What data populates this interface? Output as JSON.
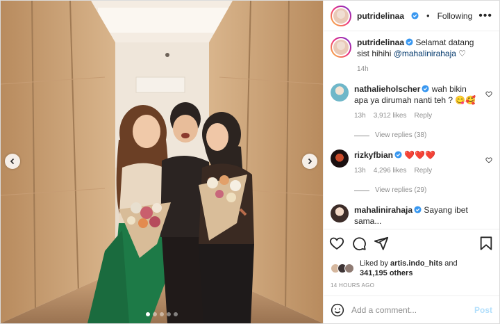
{
  "header": {
    "username": "putridelinaa",
    "separator": "•",
    "follow_status": "Following",
    "more_label": "•••"
  },
  "comments": [
    {
      "username": "putridelinaa",
      "text": "Selamat datang sist hihihi",
      "mention": "@mahalinirahaja",
      "suffix": "♡",
      "time": "14h"
    },
    {
      "username": "nathalieholscher",
      "text": "wah bikin apa ya dirumah nanti teh ? 😋🥰",
      "time": "13h",
      "likes": "3,912 likes",
      "reply": "Reply",
      "view_replies": "View replies (38)"
    },
    {
      "username": "rizkyfbian",
      "text": "❤️❤️❤️",
      "time": "13h",
      "likes": "4,296 likes",
      "reply": "Reply",
      "view_replies": "View replies (29)"
    },
    {
      "username": "mahalinirahaja",
      "text": "Sayang ibet sama..."
    }
  ],
  "liked_by": {
    "prefix": "Liked by",
    "user": "artis.indo_hits",
    "joiner": "and",
    "count": "341,195 others"
  },
  "timestamp": "14 HOURS AGO",
  "add_comment": {
    "placeholder": "Add a comment...",
    "post_label": "Post"
  },
  "carousel": {
    "total": 5,
    "active_index": 0
  },
  "colors": {
    "verified": "#3897f0",
    "link": "#00376b",
    "post_disabled": "#b2dffc",
    "heart_red": "#ed4956"
  },
  "icons": [
    "chevron-left-icon",
    "chevron-right-icon",
    "more-icon",
    "heart-icon",
    "comment-icon",
    "share-icon",
    "bookmark-icon",
    "emoji-icon",
    "verified-icon"
  ]
}
